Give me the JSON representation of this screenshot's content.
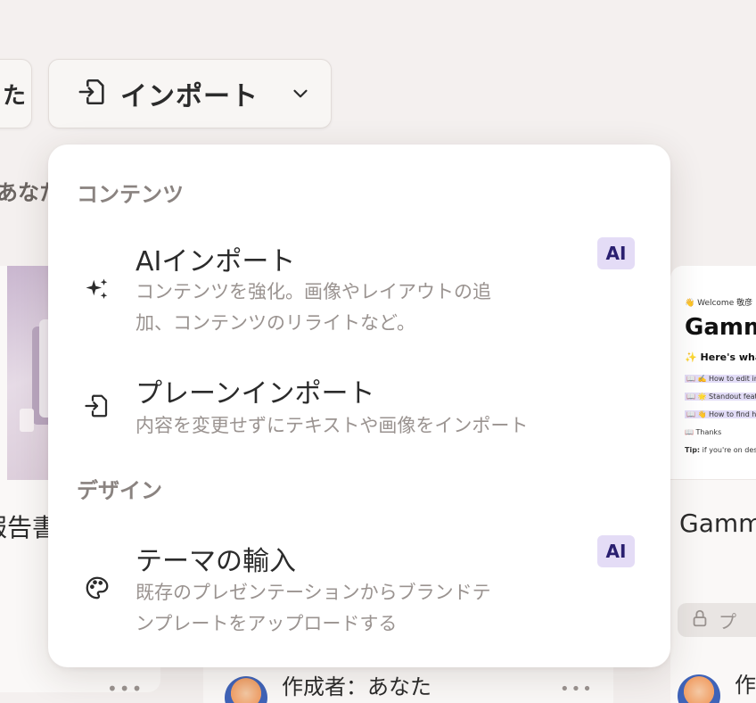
{
  "toolbar": {
    "prev_button_glyph": "た",
    "import_label": "インポート"
  },
  "section_label": "あなた",
  "cards": {
    "left_title": "報告書",
    "right_welcome": "👋 Welcome 敬彦",
    "right_big": "Gamma",
    "right_heading": "✨ Here's what",
    "right_items": [
      "📖 ✍️ How to edit in Gam",
      "📖 🌟 Standout features",
      "📖 👋 How to find help",
      "📖 Thanks"
    ],
    "right_tip_bold": "Tip:",
    "right_tip": " if you're on desktop",
    "right_title": "Gamm",
    "right_lock_label": "プ",
    "author_label": "作成者：あなた",
    "author_label_right": "作",
    "more": "•••"
  },
  "menu": {
    "groups": {
      "content": "コンテンツ",
      "design": "デザイン"
    },
    "items": [
      {
        "title": "AIインポート",
        "desc_line1": "コンテンツを強化。画像やレイアウトの追",
        "desc_line2": "加、コンテンツのリライトなど。",
        "badge": "AI",
        "icon": "sparkles-icon"
      },
      {
        "title": "プレーンインポート",
        "desc_line1": "内容を変更せずにテキストや画像をインポート",
        "icon": "import-icon"
      },
      {
        "title": "テーマの輸入",
        "desc_line1": "既存のプレゼンテーションからブランドテ",
        "desc_line2": "ンプレートをアップロードする",
        "badge": "AI",
        "icon": "palette-icon"
      }
    ]
  }
}
